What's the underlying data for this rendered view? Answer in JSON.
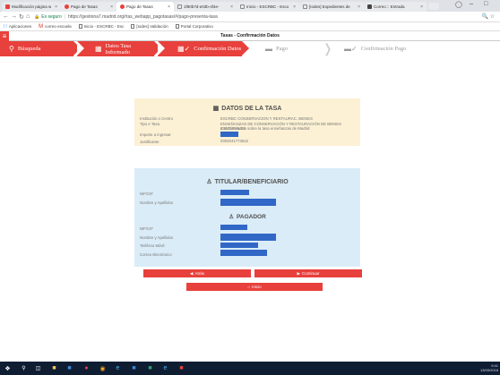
{
  "browser": {
    "tabs": [
      {
        "label": "Modificación página w",
        "color": "#e8403c"
      },
      {
        "label": "Pago de Tasas",
        "color": "#e8403c"
      },
      {
        "label": "Pago de Tasas",
        "color": "#e8403c"
      },
      {
        "label": "1f90b7d-e03b-4f4e-",
        "color": "#9aa0a6"
      },
      {
        "label": "Inicio - ESCRBC - Esco",
        "color": "#9aa0a6"
      },
      {
        "label": "[Iodes] Expedientes de",
        "color": "#9aa0a6"
      },
      {
        "label": "Correo :: Entrada",
        "color": "#444444"
      }
    ],
    "secure_label": "Es seguro",
    "url": "https://gestiona7.madrid.org/rtas_webapp_pagotasas/#/pago-presenta-tasa",
    "bookmarks": [
      "Aplicaciones",
      "correo escuela",
      "Inicio - ESCRBC - Esc",
      "[Iodes] Validación",
      "Portal Corporativo"
    ]
  },
  "app": {
    "title": "Tasas - Confirmación Datos",
    "steps": [
      "Búsqueda",
      "Datos Tasa Informado",
      "Confirmación Datos",
      "Pago",
      "Confirmación Pago"
    ]
  },
  "tasa": {
    "heading": "DATOS DE LA TASA",
    "rows": [
      {
        "label": "Institución o Centro",
        "value": "ESCRBC CONSERVACION Y RESTAURAC. BIENES"
      },
      {
        "label": "Tipo e Tasa",
        "value": "ENSEÑANZAS DE CONSERVACIÓN Y RESTAURACIÓN DE BIENES CULTURALES"
      },
      {
        "label": "",
        "value": "a.Matriculacion sobre la tasa enseñanzas de Madrid"
      },
      {
        "label": "Importe a ingresar",
        "value": ""
      },
      {
        "label": "Justificante",
        "value": "0302041773542"
      }
    ]
  },
  "titular": {
    "heading": "TITULAR/BENEFICIARIO",
    "rows": [
      {
        "label": "NIF/CIF"
      },
      {
        "label": "Nombre y Apellidos"
      }
    ]
  },
  "pagador": {
    "heading": "PAGADOR",
    "rows": [
      {
        "label": "NIF/CIF"
      },
      {
        "label": "Nombre y Apellidos"
      },
      {
        "label": "Teléfono Móvil"
      },
      {
        "label": "Correo Electrónico"
      }
    ]
  },
  "buttons": {
    "back": "Atrás",
    "continue": "Continuar",
    "home": "Inicio"
  },
  "taskbar": {
    "time": "9:41",
    "date": "13/09/2018"
  },
  "colors": {
    "accent": "#e8403c",
    "masked": "#3167c6",
    "yellow_panel": "#fcf1d4",
    "blue_panel": "#daecf7"
  }
}
